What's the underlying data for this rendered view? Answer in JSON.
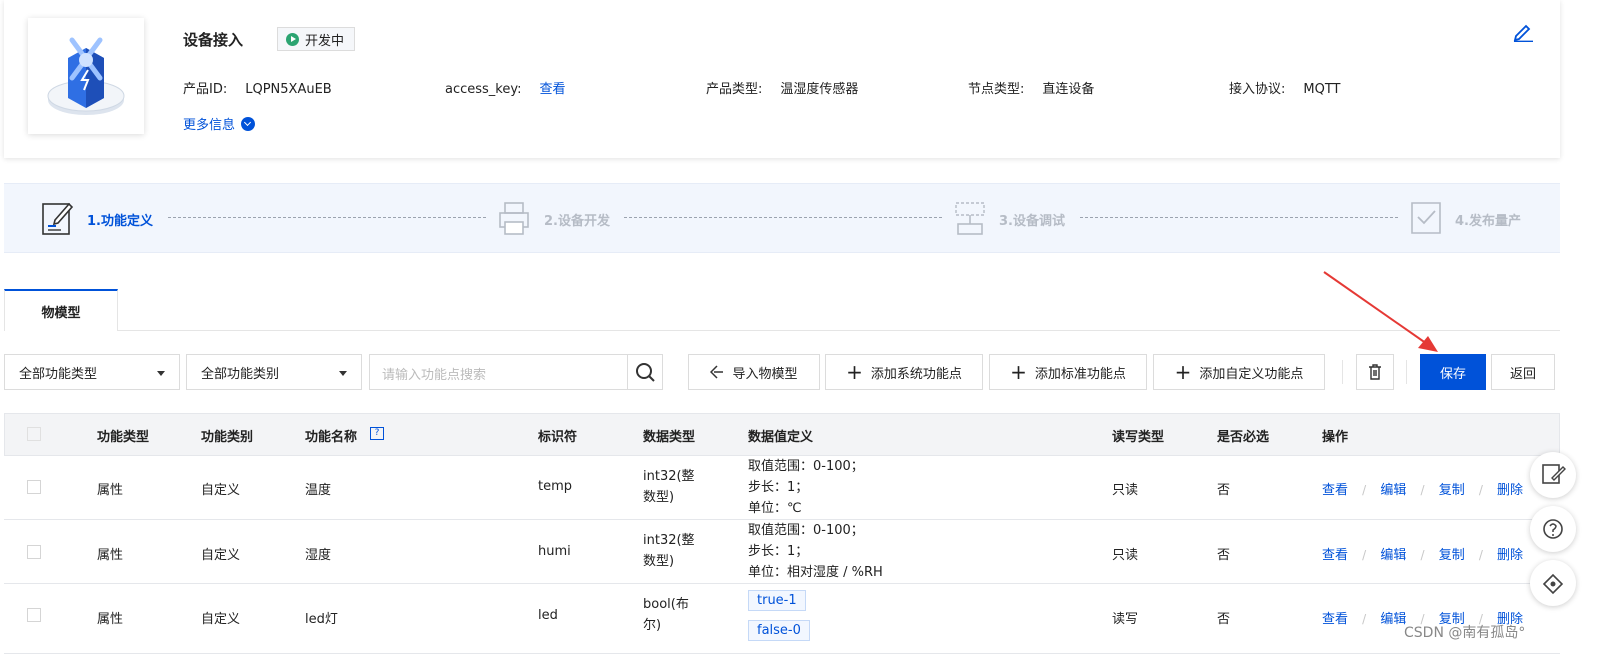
{
  "product": {
    "title": "设备接入",
    "status": "开发中",
    "fields": [
      {
        "label": "产品ID:",
        "value": "LQPN5XAuEB"
      },
      {
        "label": "access_key:",
        "value": "查看"
      },
      {
        "label": "产品类型:",
        "value": "温湿度传感器"
      },
      {
        "label": "节点类型:",
        "value": "直连设备"
      },
      {
        "label": "接入协议:",
        "value": "MQTT"
      }
    ],
    "more": "更多信息"
  },
  "steps": [
    {
      "label": "1.功能定义",
      "active": true
    },
    {
      "label": "2.设备开发",
      "active": false
    },
    {
      "label": "3.设备调试",
      "active": false
    },
    {
      "label": "4.发布量产",
      "active": false
    }
  ],
  "tabs": [
    "物模型"
  ],
  "toolbar": {
    "type_select": "全部功能类型",
    "category_select": "全部功能类别",
    "search_placeholder": "请输入功能点搜索",
    "import": "导入物模型",
    "add_system": "添加系统功能点",
    "add_standard": "添加标准功能点",
    "add_custom": "添加自定义功能点",
    "save": "保存",
    "back": "返回"
  },
  "table": {
    "headers": [
      "功能类型",
      "功能类别",
      "功能名称",
      "标识符",
      "数据类型",
      "数据值定义",
      "读写类型",
      "是否必选",
      "操作"
    ],
    "rows": [
      {
        "type": "属性",
        "category": "自定义",
        "name": "温度",
        "id": "temp",
        "dtype": [
          "int32(整",
          "数型)"
        ],
        "def": [
          "取值范围：0-100；",
          "步长：1；",
          "单位：℃"
        ],
        "rw": "只读",
        "required": "否"
      },
      {
        "type": "属性",
        "category": "自定义",
        "name": "湿度",
        "id": "humi",
        "dtype": [
          "int32(整",
          "数型)"
        ],
        "def": [
          "取值范围：0-100；",
          "步长：1；",
          "单位：相对湿度 / %RH"
        ],
        "rw": "只读",
        "required": "否"
      },
      {
        "type": "属性",
        "category": "自定义",
        "name": "led灯",
        "id": "led",
        "dtype": [
          "bool(布",
          "尔)"
        ],
        "tags": [
          "true-1",
          "false-0"
        ],
        "rw": "读写",
        "required": "否"
      }
    ],
    "ops": [
      "查看",
      "编辑",
      "复制",
      "删除"
    ],
    "op_sep": "/"
  },
  "watermark": "CSDN @南有孤岛°",
  "colors": {
    "primary": "#0052d9",
    "status_green": "#2ba471",
    "arrow": "#e53935"
  }
}
